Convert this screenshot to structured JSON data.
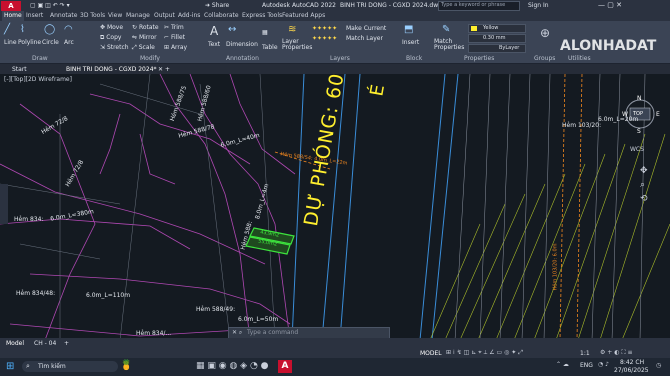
{
  "app": {
    "logo": "A",
    "version": "Autodesk AutoCAD 2022",
    "file": "BINH TRI DONG - CGXD 2024.dwg",
    "search_placeholder": "Type a keyword or phrase",
    "user": "Sign In"
  },
  "ribbon_tabs": [
    "Home",
    "Insert",
    "Annotate",
    "3D Tools",
    "View",
    "Manage",
    "Output",
    "Add-ins",
    "Collaborate",
    "Express Tools",
    "Featured Apps"
  ],
  "ribbon": {
    "draw": [
      "Line",
      "Polyline",
      "Circle",
      "Arc"
    ],
    "modify": [
      "Move",
      "Rotate",
      "Trim",
      "Copy",
      "Mirror",
      "Fillet",
      "Stretch",
      "Scale",
      "Array"
    ],
    "annotation": [
      "Text",
      "Dimension",
      "Table"
    ],
    "layers": [
      "Layer Properties",
      "Make Current",
      "Match Layer"
    ],
    "block": [
      "Insert"
    ],
    "properties": [
      "Match Properties",
      "Yellow",
      "0.30 mm",
      "ByLayer"
    ],
    "groups": [
      "Draw",
      "Modify",
      "Annotation",
      "Layers",
      "Block",
      "Properties",
      "Groups",
      "Utilities"
    ]
  },
  "doc_tabs": [
    "Start",
    "BINH TRI DONG - CGXD 2024*"
  ],
  "viewport_label": "[-][Top][2D Wireframe]",
  "compass": {
    "n": "N",
    "w": "W",
    "e": "E",
    "s": "S",
    "center": "TOP",
    "wcs": "WCS"
  },
  "drawing_text": {
    "road": "DỰ PHÓNG: 60,0m",
    "road_char": "É",
    "h72": "Hẻm 72/8",
    "h72b": "Hẻm 72/8",
    "h834": "Hẻm 834:",
    "h834_dim": "6.0m_L=380m",
    "h58875": "Hẻm 588/75",
    "h58860": "Hẻm 588/60",
    "h58878": "Hẻm 588/78",
    "h588_dim": "6.0m_L=40m",
    "h58854": "Hẻm 588/54: 4.0m_L=22m",
    "h588": "Hẻm 588:",
    "h588_dim2": "8.0m_L=4m",
    "h83448": "Hẻm 834/48:",
    "h83448_dim": "6.0m_L=110m",
    "h58849": "Hẻm 588/49:",
    "h58849_dim": "6.0m_L=50m",
    "h834b": "Hẻm 834/...",
    "h10320": "Hẻm 103/20:",
    "h10320_dim": "6.0m_L=20m",
    "vert_right": "Hẻm 103/20: 6.0m",
    "lot1": "43,9m2",
    "lot2": "55,0m2",
    "cmd_placeholder": "Type a command"
  },
  "layout_tabs": [
    "Model",
    "CH - 04"
  ],
  "statusbar": {
    "model": "MODEL",
    "scale": "1:1"
  },
  "watermark": {
    "text": "ALONHADAT",
    ".com": ".com.vn"
  },
  "taskbar": {
    "search": "Tìm kiếm",
    "lang": "ENG",
    "time": "8:42 CH",
    "date": "27/06/2025"
  },
  "colors": {
    "bg": "#141a21",
    "road": "#ffef2e",
    "lot": "#3de33d",
    "orange": "#f0871f",
    "street": "#3a8dd8",
    "wall": "#b048b3"
  }
}
